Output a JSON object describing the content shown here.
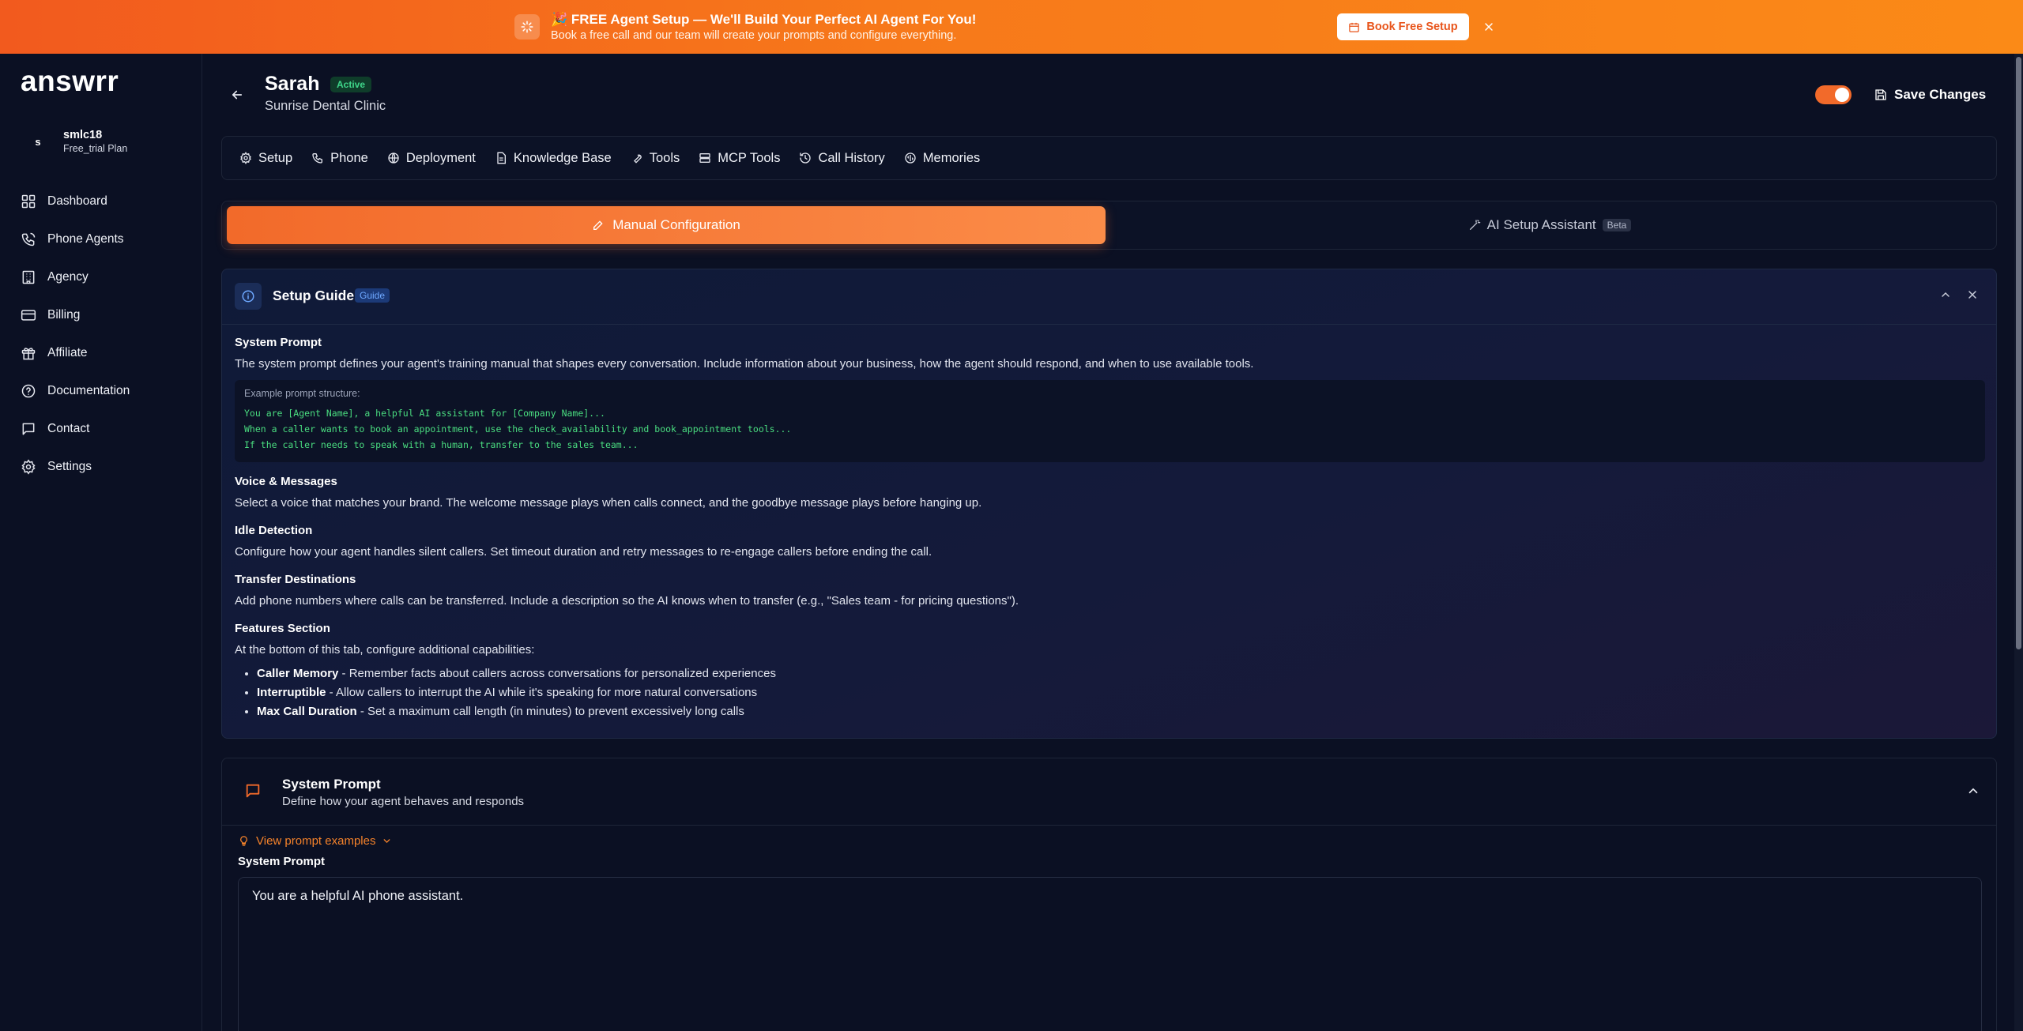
{
  "banner": {
    "title": "🎉 FREE Agent Setup — We'll Build Your Perfect AI Agent For You!",
    "subtitle": "Book a free call and our team will create your prompts and configure everything.",
    "button_label": "Book Free Setup"
  },
  "sidebar": {
    "logo": "answrr",
    "user": {
      "initial": "s",
      "name": "smlc18",
      "plan": "Free_trial Plan"
    },
    "items": [
      {
        "label": "Dashboard",
        "icon": "dashboard-icon"
      },
      {
        "label": "Phone Agents",
        "icon": "phone-icon"
      },
      {
        "label": "Agency",
        "icon": "building-icon"
      },
      {
        "label": "Billing",
        "icon": "credit-card-icon"
      },
      {
        "label": "Affiliate",
        "icon": "gift-icon"
      },
      {
        "label": "Documentation",
        "icon": "help-icon"
      },
      {
        "label": "Contact",
        "icon": "message-icon"
      },
      {
        "label": "Settings",
        "icon": "gear-icon"
      }
    ]
  },
  "header": {
    "agent_name": "Sarah",
    "status": "Active",
    "company": "Sunrise Dental Clinic",
    "save_label": "Save Changes",
    "enabled": true
  },
  "tabs": [
    {
      "label": "Setup",
      "icon": "gear-icon"
    },
    {
      "label": "Phone",
      "icon": "phone-icon"
    },
    {
      "label": "Deployment",
      "icon": "globe-icon"
    },
    {
      "label": "Knowledge Base",
      "icon": "document-icon"
    },
    {
      "label": "Tools",
      "icon": "wrench-icon"
    },
    {
      "label": "MCP Tools",
      "icon": "server-icon"
    },
    {
      "label": "Call History",
      "icon": "history-icon"
    },
    {
      "label": "Memories",
      "icon": "brain-icon"
    }
  ],
  "modes": {
    "manual": "Manual Configuration",
    "ai": "AI Setup Assistant",
    "ai_badge": "Beta"
  },
  "guide": {
    "title": "Setup Guide",
    "badge": "Guide",
    "system_prompt_heading": "System Prompt",
    "system_prompt_text": "The system prompt defines your agent's training manual that shapes every conversation. Include information about your business, how the agent should respond, and when to use available tools.",
    "example_label": "Example prompt structure:",
    "example_lines": [
      "You are [Agent Name], a helpful AI assistant for [Company Name]...",
      "When a caller wants to book an appointment, use the check_availability and book_appointment tools...",
      "If the caller needs to speak with a human, transfer to the sales team..."
    ],
    "voice_heading": "Voice & Messages",
    "voice_text": "Select a voice that matches your brand. The welcome message plays when calls connect, and the goodbye message plays before hanging up.",
    "idle_heading": "Idle Detection",
    "idle_text": "Configure how your agent handles silent callers. Set timeout duration and retry messages to re-engage callers before ending the call.",
    "transfer_heading": "Transfer Destinations",
    "transfer_text": "Add phone numbers where calls can be transferred. Include a description so the AI knows when to transfer (e.g., \"Sales team - for pricing questions\").",
    "features_heading": "Features Section",
    "features_text": "At the bottom of this tab, configure additional capabilities:",
    "features": [
      {
        "name": "Caller Memory",
        "desc": " - Remember facts about callers across conversations for personalized experiences"
      },
      {
        "name": "Interruptible",
        "desc": " - Allow callers to interrupt the AI while it's speaking for more natural conversations"
      },
      {
        "name": "Max Call Duration",
        "desc": " - Set a maximum call length (in minutes) to prevent excessively long calls"
      }
    ]
  },
  "system_prompt": {
    "title": "System Prompt",
    "subtitle": "Define how your agent behaves and responds",
    "examples_link": "View prompt examples",
    "field_label": "System Prompt",
    "value": "You are a helpful AI phone assistant."
  },
  "colors": {
    "accent": "#f26a2a",
    "background": "#0b1023",
    "success": "#3fd68a",
    "info": "#6ea8ff"
  }
}
